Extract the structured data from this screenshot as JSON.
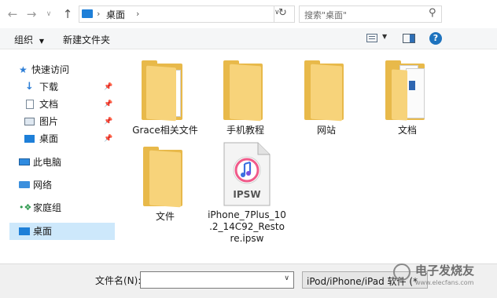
{
  "address_bar": {
    "path_segment": "桌面",
    "search_placeholder": "搜索\"桌面\""
  },
  "toolbar": {
    "organize_label": "组织",
    "new_folder_label": "新建文件夹"
  },
  "sidebar": {
    "quick_access": "快速访问",
    "downloads": "下载",
    "documents": "文档",
    "pictures": "图片",
    "desktop": "桌面",
    "this_pc": "此电脑",
    "network": "网络",
    "homegroup": "家庭组",
    "desktop_root": "桌面"
  },
  "files": [
    {
      "name": "Grace相关文件",
      "icon": "folder"
    },
    {
      "name": "手机教程",
      "icon": "folder"
    },
    {
      "name": "网站",
      "icon": "folder"
    },
    {
      "name": "文档",
      "icon": "folder-with-documents"
    },
    {
      "name": "文件",
      "icon": "folder"
    },
    {
      "name_lines": [
        "iPhone_7Plus_10",
        ".2_14C92_Resto",
        "re.ipsw"
      ],
      "icon": "ipsw-file",
      "icon_label": "IPSW"
    }
  ],
  "footer": {
    "filename_label": "文件名(N):",
    "filename_value": "",
    "filetype_value": "iPod/iPhone/iPad 软件 (*"
  },
  "watermark": {
    "text": "电子发烧友",
    "url": "www.elecfans.com"
  },
  "colors": {
    "folder": "#f7d37a",
    "selection": "#cde8fb",
    "accent": "#1e7fd8"
  }
}
